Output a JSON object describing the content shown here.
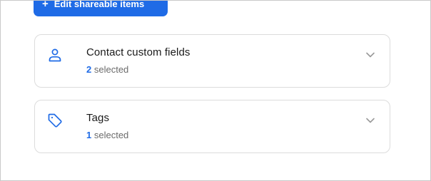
{
  "toolbar": {
    "edit_button_icon": "plus-icon",
    "edit_button_label": "Edit shareable items"
  },
  "sections": [
    {
      "icon": "person-icon",
      "title": "Contact custom fields",
      "selected_count": "2",
      "selected_suffix": "selected",
      "expanded": false
    },
    {
      "icon": "tag-icon",
      "title": "Tags",
      "selected_count": "1",
      "selected_suffix": "selected",
      "expanded": false
    }
  ],
  "colors": {
    "accent": "#1f6be6",
    "card_border": "#dcdcdc",
    "muted_text": "#6b6b6b",
    "chevron": "#9a9a9a"
  }
}
